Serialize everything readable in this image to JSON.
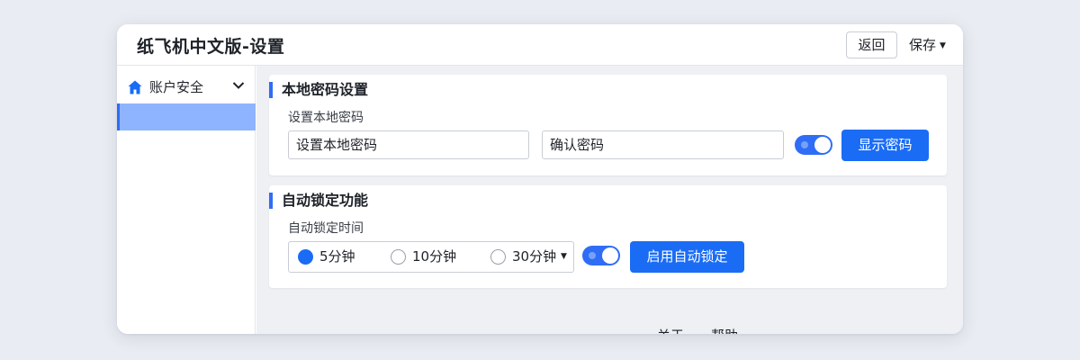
{
  "window": {
    "title": "纸飞机中文版-设置",
    "back_label": "返回",
    "save_label": "保存"
  },
  "sidebar": {
    "items": [
      {
        "icon": "home-icon",
        "label": "账户安全",
        "expanded": true
      }
    ]
  },
  "password_section": {
    "title": "本地密码设置",
    "field_label": "设置本地密码",
    "password_placeholder": "设置本地密码",
    "confirm_placeholder": "确认密码",
    "toggle_on": true,
    "show_button_label": "显示密码"
  },
  "autolock_section": {
    "title": "自动锁定功能",
    "field_label": "自动锁定时间",
    "options": [
      {
        "label": "5分钟",
        "checked": true
      },
      {
        "label": "10分钟",
        "checked": false
      },
      {
        "label": "30分钟",
        "checked": false
      }
    ],
    "toggle_on": true,
    "enable_button_label": "启用自动锁定"
  },
  "footer": {
    "about_label": "关于",
    "help_label": "帮助"
  },
  "colors": {
    "accent": "#1a6cf5",
    "sidebar_selected": "#8fb4ff",
    "background": "#eef0f4"
  }
}
